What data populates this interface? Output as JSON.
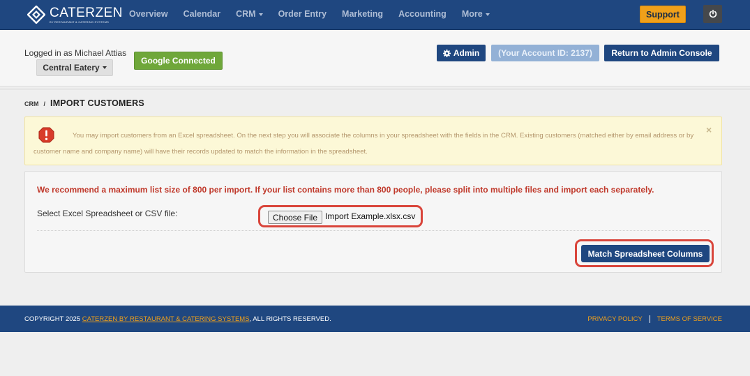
{
  "brand": {
    "name": "CATERZEN",
    "tagline": "BY RESTAURANT & CATERING SYSTEMS"
  },
  "nav": {
    "items": [
      {
        "label": "Overview",
        "dropdown": false
      },
      {
        "label": "Calendar",
        "dropdown": false
      },
      {
        "label": "CRM",
        "dropdown": true
      },
      {
        "label": "Order Entry",
        "dropdown": false
      },
      {
        "label": "Marketing",
        "dropdown": false
      },
      {
        "label": "Accounting",
        "dropdown": false
      },
      {
        "label": "More",
        "dropdown": true
      }
    ],
    "support_label": "Support",
    "power_icon": "power-icon"
  },
  "account": {
    "logged_in_text": "Logged in as Michael Attias",
    "store_label": "Central Eatery",
    "google_label": "Google Connected",
    "admin_label": "Admin",
    "account_id_label": "(Your Account ID: 2137)",
    "return_label": "Return to Admin Console"
  },
  "breadcrumb": {
    "root": "CRM",
    "separator": "/",
    "current": "IMPORT CUSTOMERS"
  },
  "alert": {
    "text": "You may import customers from an Excel spreadsheet. On the next step you will associate the columns in your spreadsheet with the fields in the CRM. Existing customers (matched either by email address or by customer name and company name) will have their records updated to match the information in the spreadsheet.",
    "close": "×"
  },
  "import_form": {
    "warning": "We recommend a maximum list size of 800 per import. If your list contains more than 800 people, please split into multiple files and import each separately.",
    "file_label": "Select Excel Spreadsheet or CSV file:",
    "choose_label": "Choose File",
    "file_name": "Import Example.xlsx.csv",
    "submit_label": "Match Spreadsheet Columns"
  },
  "footer": {
    "copyright_prefix": "COPYRIGHT 2025 ",
    "copyright_link": "CATERZEN BY RESTAURANT & CATERING SYSTEMS",
    "copyright_suffix": ", ALL RIGHTS RESERVED.",
    "privacy": "PRIVACY POLICY",
    "terms": "TERMS OF SERVICE"
  },
  "colors": {
    "navbar": "#1f4780",
    "accent": "#f0a01a",
    "google": "#6fa73a",
    "warning": "#c0392b",
    "alert_bg": "#fcf8d7",
    "highlight": "#d9453b"
  }
}
